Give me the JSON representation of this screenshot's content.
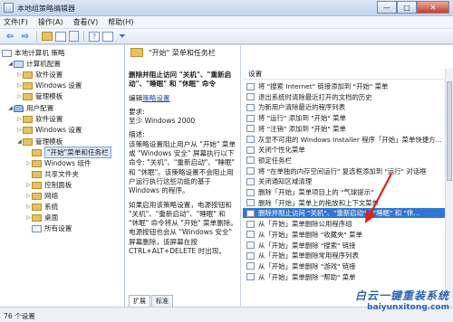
{
  "window": {
    "title": "本地组策略编辑器",
    "controls": {
      "minimize": "—",
      "maximize": "□",
      "close": "✕"
    }
  },
  "menu": [
    "文件(F)",
    "操作(A)",
    "查看(V)",
    "帮助(H)"
  ],
  "tree": {
    "items": [
      {
        "label": "本地计算机 策略"
      },
      {
        "label": "计算机配置"
      },
      {
        "label": "软件设置"
      },
      {
        "label": "Windows 设置"
      },
      {
        "label": "管理模板"
      },
      {
        "label": "用户配置"
      },
      {
        "label": "软件设置"
      },
      {
        "label": "Windows 设置"
      },
      {
        "label": "管理模板"
      },
      {
        "label": "\"开始\"菜单和任务栏"
      },
      {
        "label": "Windows 组件"
      },
      {
        "label": "共享文件夹"
      },
      {
        "label": "控制面板"
      },
      {
        "label": "网络"
      },
      {
        "label": "系统"
      },
      {
        "label": "桌面"
      },
      {
        "label": "所有设置"
      }
    ]
  },
  "middle": {
    "header": "\"开始\" 菜单和任务栏",
    "policy_title": "删除并阻止访问 \"关机\"、\"重新启动\"、\"睡眠\" 和 \"休眠\" 命令",
    "edit_prefix": "编辑",
    "edit_link": "策略设置",
    "req_label": "要求:",
    "req_value": "至少 Windows 2000",
    "desc_label": "描述:",
    "desc_1": "该策略设置阻止用户从 \"开始\" 菜单或 \"Windows 安全\" 屏幕执行以下命令: \"关机\"、\"重新启动\"、\"睡眠\" 和 \"休眠\"。该策略设置不会阻止用户运行执行这些功能的基于 Windows 的程序。",
    "desc_2": "如果启用该策略设置，电源按钮和 \"关机\"、\"重新启动\"、\"睡眠\" 和 \"休眠\" 命令将从 \"开始\" 菜单删除。电源按钮也会从 \"Windows 安全\" 屏幕删除，该屏幕在按 CTRL+ALT+DELETE 时出现。",
    "tabs": [
      "扩展",
      "标准"
    ]
  },
  "settings": {
    "column_header": "设置",
    "rows": [
      "将 \"搜索 Internet\" 链接添加到 \"开始\" 菜单",
      "退出系统时清除最近打开的文档的历史",
      "为新用户清除最近的程序列表",
      "将 \"运行\" 添加到 \"开始\" 菜单",
      "将 \"注销\" 添加到 \"开始\" 菜单",
      "灰显不可用的 Windows Installer 程序「开始」菜单快捷方…",
      "关闭个性化菜单",
      "锁定任务栏",
      "将 \"在单独的内存空间运行\" 复选框添加到 \"运行\" 对话框",
      "关闭通知区域清理",
      "删除「开始」菜单项目上的 \"气球提示\"",
      "删除「开始」菜单上的拖放和上下文菜单",
      "删除并阻止访问 \"关机\"、\"重新启动\"、\"睡眠\" 和 \"休…",
      "从「开始」菜单删除公用程序组",
      "从「开始」菜单删除 \"收藏夹\" 菜单",
      "从「开始」菜单删除 \"搜索\" 链接",
      "从「开始」菜单删除常用程序列表",
      "从「开始」菜单删除 \"游戏\" 链接",
      "从「开始」菜单删除 \"帮助\" 菜单"
    ],
    "selected_index": 12
  },
  "status": {
    "text": "76 个设置"
  },
  "watermark": {
    "main": "白云一键重装系统",
    "url": "baiyunxitong.com"
  }
}
